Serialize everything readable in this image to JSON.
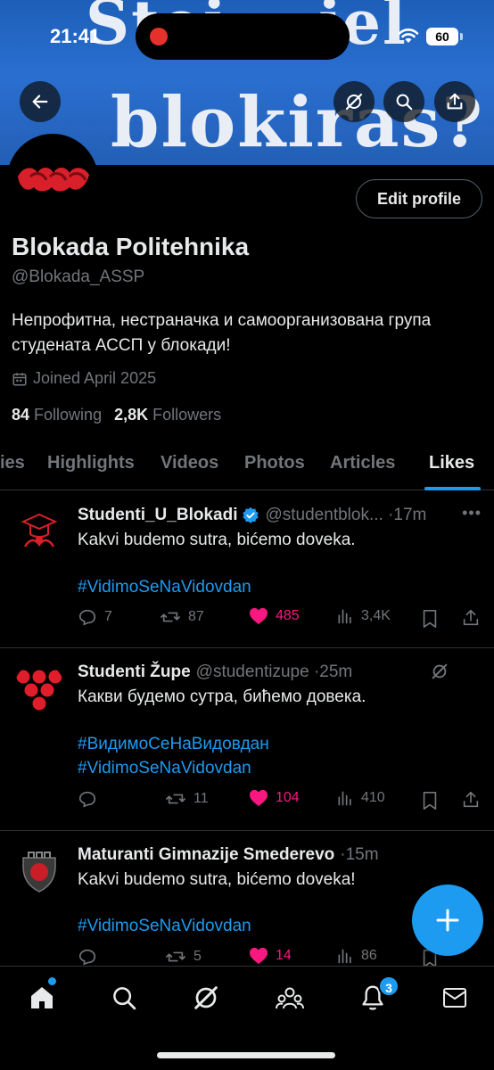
{
  "status_bar": {
    "time": "21:41",
    "battery": "60"
  },
  "banner": {
    "line1": "Stoj... jel",
    "line2": "blokiras?"
  },
  "profile": {
    "name": "Blokada Politehnika",
    "handle": "@Blokada_ASSP",
    "bio": "Непрофитна, нестраначка и самоорганизована група студената АССП у блокади!",
    "joined": "Joined April 2025",
    "following_count": "84",
    "following_label": "Following",
    "followers_count": "2,8K",
    "followers_label": "Followers",
    "edit_button": "Edit profile"
  },
  "tabs": [
    "ies",
    "Highlights",
    "Videos",
    "Photos",
    "Articles",
    "Likes"
  ],
  "active_tab": "Likes",
  "posts": [
    {
      "author": "Studenti_U_Blokadi",
      "verified": true,
      "handle_time": "@studentblok... ·17m",
      "text": "Kakvi budemo sutra, bićemo doveka.",
      "hashtags": [
        "#VidimoSeNaVidovdan"
      ],
      "replies": "7",
      "reposts": "87",
      "likes": "485",
      "views": "3,4K"
    },
    {
      "author": "Studenti Župe",
      "verified": false,
      "handle_time": "@studentizupe ·25m",
      "text": "Какви будемо сутра, бићемо довека.",
      "hashtags": [
        "#ВидимоСеНаВидовдан",
        "#VidimoSeNaVidovdan"
      ],
      "replies": "",
      "reposts": "11",
      "likes": "104",
      "views": "410"
    },
    {
      "author": "Maturanti Gimnazije Smederevo",
      "verified": false,
      "handle_time": "·15m",
      "text": "Kakvi budemo sutra, bićemo doveka!",
      "hashtags": [
        "#VidimoSeNaVidovdan"
      ],
      "replies": "",
      "reposts": "5",
      "likes": "14",
      "views": "86"
    }
  ],
  "nav": {
    "notifications_badge": "3"
  },
  "colors": {
    "accent": "#1d9bf0",
    "like": "#f91880",
    "muted": "#71767b",
    "text": "#e7e9ea",
    "banner": "#2a6fd0"
  }
}
